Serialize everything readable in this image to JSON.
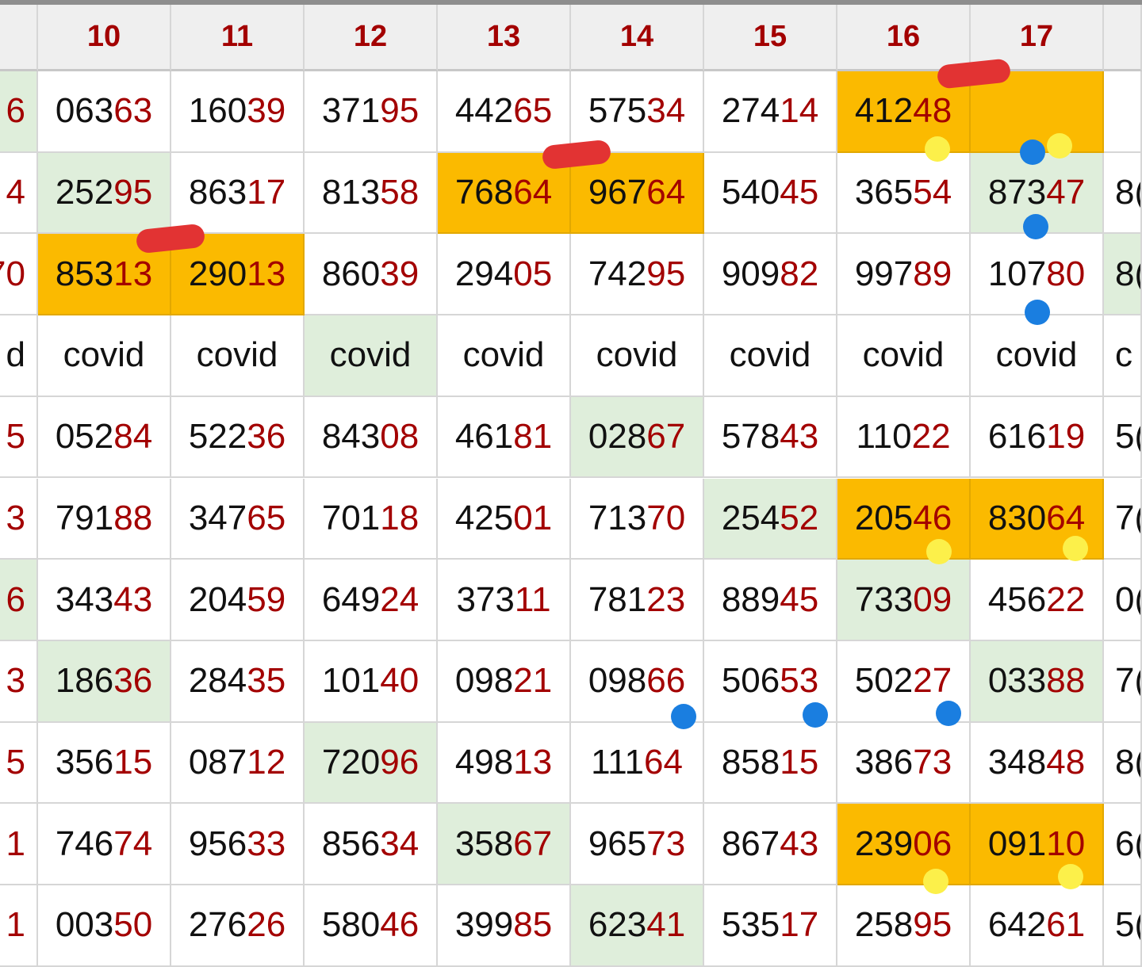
{
  "columns": [
    "10",
    "11",
    "12",
    "13",
    "14",
    "15",
    "16",
    "17"
  ],
  "rows": [
    {
      "left": "6",
      "cells": [
        "06363",
        "16039",
        "37195",
        "44265",
        "57534",
        "27414",
        "41248",
        ""
      ],
      "right": ""
    },
    {
      "left": "4",
      "cells": [
        "25295",
        "86317",
        "81358",
        "76864",
        "96764",
        "54045",
        "36554",
        "87347"
      ],
      "right": "8("
    },
    {
      "left": "70",
      "cells": [
        "85313",
        "29013",
        "86039",
        "29405",
        "74295",
        "90982",
        "99789",
        "10780"
      ],
      "right": "8("
    },
    {
      "left": "d",
      "cells": [
        "covid",
        "covid",
        "covid",
        "covid",
        "covid",
        "covid",
        "covid",
        "covid"
      ],
      "right": "c"
    },
    {
      "left": "5",
      "cells": [
        "05284",
        "52236",
        "84308",
        "46181",
        "02867",
        "57843",
        "11022",
        "61619"
      ],
      "right": "5("
    },
    {
      "left": "3",
      "cells": [
        "79188",
        "34765",
        "70118",
        "42501",
        "71370",
        "25452",
        "20546",
        "83064"
      ],
      "right": "7("
    },
    {
      "left": "6",
      "cells": [
        "34343",
        "20459",
        "64924",
        "37311",
        "78123",
        "88945",
        "73309",
        "45622"
      ],
      "right": "0("
    },
    {
      "left": "3",
      "cells": [
        "18636",
        "28435",
        "10140",
        "09821",
        "09866",
        "50653",
        "50227",
        "03388"
      ],
      "right": "7("
    },
    {
      "left": "5",
      "cells": [
        "35615",
        "08712",
        "72096",
        "49813",
        "11164",
        "85815",
        "38673",
        "34848"
      ],
      "right": "8("
    },
    {
      "left": "1",
      "cells": [
        "74674",
        "95633",
        "85634",
        "35867",
        "96573",
        "86743",
        "23906",
        "09110"
      ],
      "right": "6("
    },
    {
      "left": "1",
      "cells": [
        "00350",
        "27626",
        "58046",
        "39985",
        "62341",
        "53517",
        "25895",
        "64261"
      ],
      "right": "5("
    }
  ],
  "highlights": {
    "green": [
      [
        0,
        -1
      ],
      [
        1,
        0
      ],
      [
        1,
        7
      ],
      [
        2,
        8
      ],
      [
        3,
        2
      ],
      [
        4,
        4
      ],
      [
        5,
        5
      ],
      [
        6,
        -1
      ],
      [
        6,
        6
      ],
      [
        7,
        0
      ],
      [
        7,
        7
      ],
      [
        8,
        2
      ],
      [
        9,
        3
      ],
      [
        10,
        4
      ]
    ],
    "orange": [
      [
        0,
        6
      ],
      [
        0,
        7
      ],
      [
        1,
        3
      ],
      [
        1,
        4
      ],
      [
        2,
        0
      ],
      [
        2,
        1
      ],
      [
        5,
        6
      ],
      [
        5,
        7
      ],
      [
        9,
        6
      ],
      [
        9,
        7
      ]
    ]
  },
  "colors": {
    "header_text": "#a30000",
    "digit_accent": "#a30000",
    "green_cell": "#dfeedb",
    "orange_cell": "#fbba00",
    "blue_dot": "#1a7ee0",
    "yellow_dot": "#fcf04a",
    "red_stroke": "#e23333"
  }
}
